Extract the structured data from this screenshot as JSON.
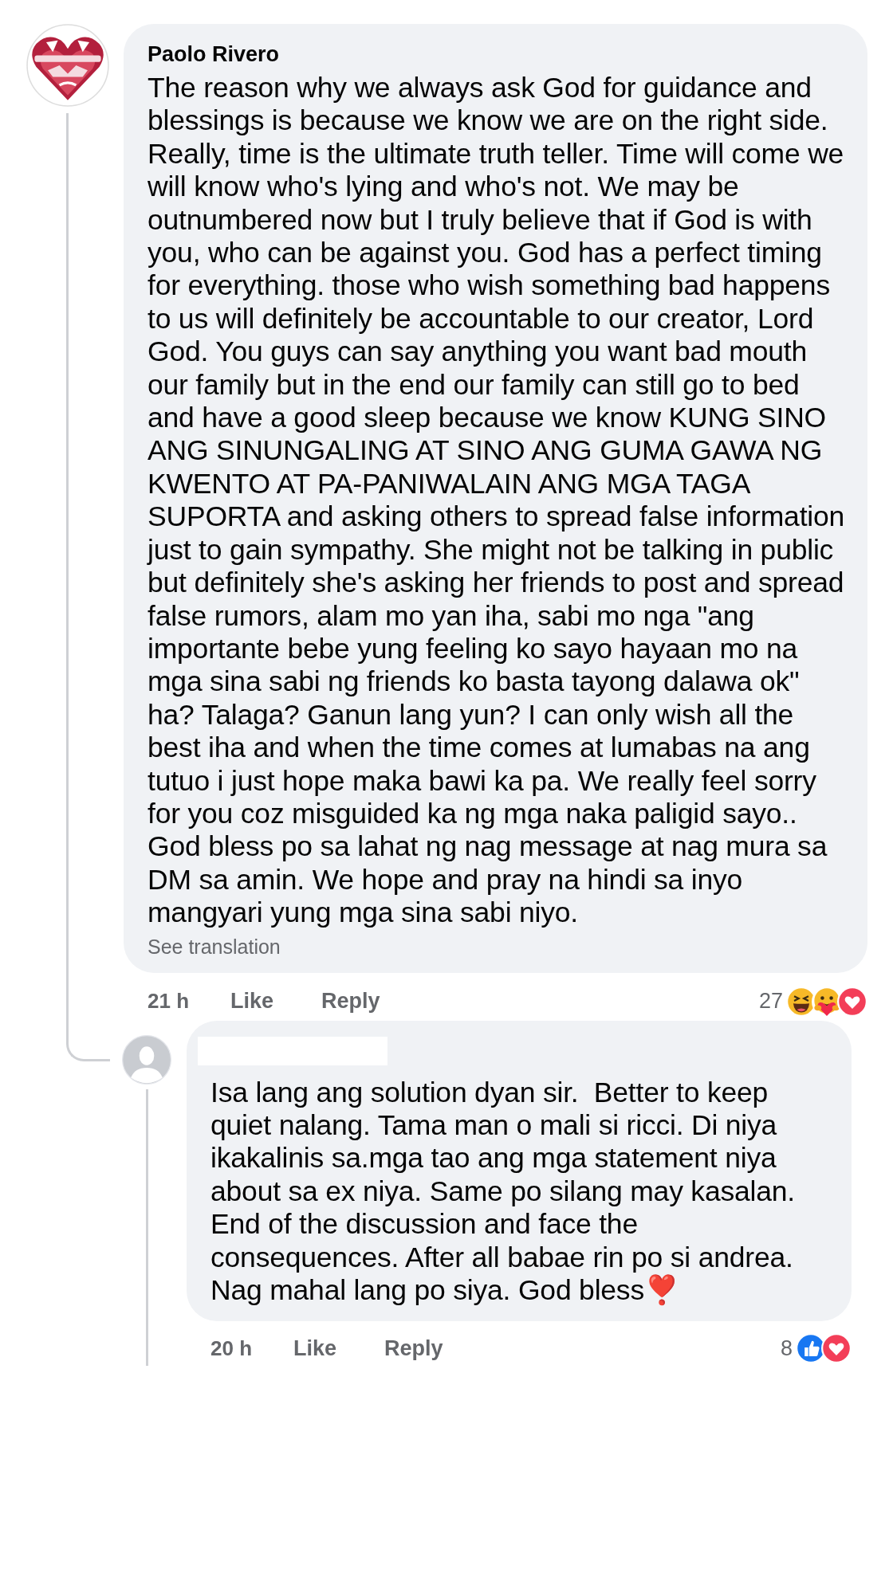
{
  "comments": [
    {
      "avatar": {
        "kind": "picture"
      },
      "author": "Paolo Rivero",
      "paragraphs": [
        "The reason why we always ask God for guidance and blessings is because we know we are on the right side. Really, time is the ultimate truth teller. Time will come we will know who's lying and who's not. We may be outnumbered now but I truly believe that if God is with you, who can be against you. God has a perfect timing for everything. those who wish something bad happens to us will definitely be accountable to our creator, Lord God. You guys can say anything you want bad mouth our family but in the end our family can still go to bed and have a good sleep because we know KUNG SINO ANG SINUNGALING AT SINO ANG GUMA GAWA NG KWENTO AT PA-PANIWALAIN ANG MGA TAGA SUPORTA and asking others to spread false information just to gain sympathy. She might not be talking in public but definitely she's asking her friends to post and spread false rumors, alam mo yan iha, sabi mo nga \"ang importante bebe yung feeling ko sayo hayaan mo na mga sina sabi ng friends ko basta tayong dalawa ok\" ha? Talaga? Ganun lang yun? I can only wish all the best iha and when the time comes at lumabas na ang tutuo i just hope maka bawi ka pa. We really feel sorry for you coz misguided ka ng mga naka paligid sayo..",
        "God bless po sa lahat ng nag message at nag mura sa DM sa amin. We hope and pray na hindi sa inyo mangyari yung mga sina sabi niyo."
      ],
      "see_translation": "See translation",
      "time": "21 h",
      "actions": [
        "Like",
        "Reply"
      ],
      "reaction_count": "27",
      "reactions": [
        {
          "kind": "haha"
        },
        {
          "kind": "care"
        },
        {
          "kind": "love"
        }
      ],
      "replies": [
        {
          "avatar": {
            "kind": "default"
          },
          "name_hidden": true,
          "paragraphs": [
            "Isa lang ang solution dyan sir.  Better to keep quiet nalang. Tama man o mali si ricci. Di niya ikakalinis sa.mga tao ang mga statement niya about sa ex niya. Same po silang may kasalan. End of the discussion and face the consequences. After all babae rin po si andrea. Nag mahal lang po siya. God bless❣️"
          ],
          "time": "20 h",
          "actions": [
            "Like",
            "Reply"
          ],
          "reaction_count": "8",
          "reactions": [
            {
              "kind": "like"
            },
            {
              "kind": "love"
            }
          ]
        }
      ]
    }
  ]
}
